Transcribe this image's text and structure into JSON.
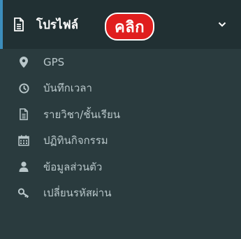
{
  "menu": {
    "header": {
      "icon": "document-icon",
      "label": "โปรไฟล์",
      "badge": "คลิก",
      "chevron": "chevron-down-icon"
    },
    "items": [
      {
        "icon": "map-marker-icon",
        "label": "GPS"
      },
      {
        "icon": "clock-icon",
        "label": "บันทึกเวลา"
      },
      {
        "icon": "document-icon",
        "label": "รายวิชา/ชั้นเรียน"
      },
      {
        "icon": "calendar-icon",
        "label": "ปฏิทินกิจกรรม"
      },
      {
        "icon": "user-icon",
        "label": "ข้อมูลส่วนตัว"
      },
      {
        "icon": "key-icon",
        "label": "เปลี่ยนรหัสผ่าน"
      }
    ]
  },
  "colors": {
    "sidebar_bg": "#2a3b3e",
    "header_bg": "#213033",
    "accent": "#3c8dbc",
    "badge": "#e01e1e",
    "item_text": "#b9c7ca"
  }
}
